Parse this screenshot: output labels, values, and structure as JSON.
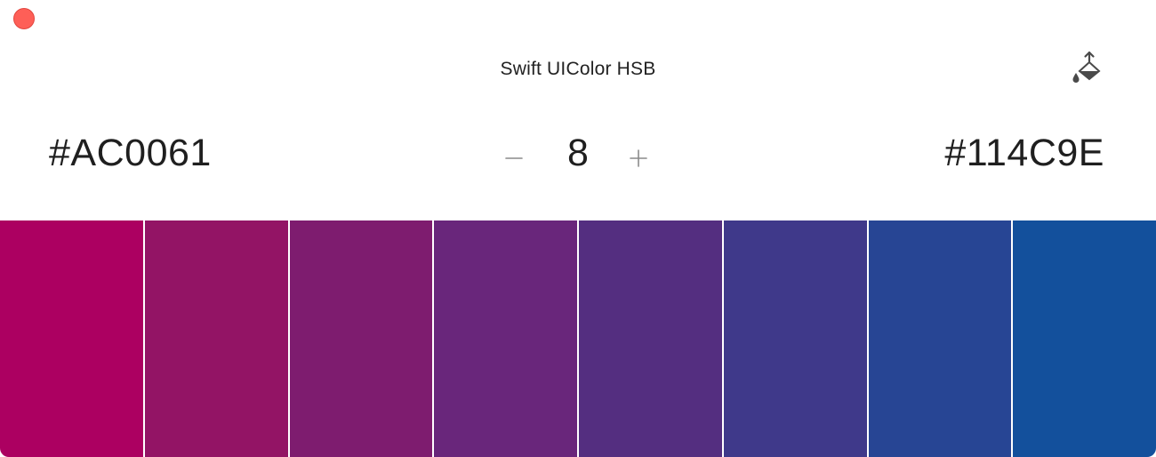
{
  "window": {
    "title": "Swift UIColor HSB",
    "close_color": "#fe5f57"
  },
  "toolbar": {
    "fill_icon": "paint-bucket-icon"
  },
  "gradient": {
    "start_hex": "#AC0061",
    "end_hex": "#114C9E",
    "steps": "8",
    "minus_icon": "minus-icon",
    "plus_icon": "plus-icon"
  },
  "swatches": [
    "#AC0061",
    "#931465",
    "#7E1C6F",
    "#69267B",
    "#542E80",
    "#3F398A",
    "#274594",
    "#13509C"
  ]
}
